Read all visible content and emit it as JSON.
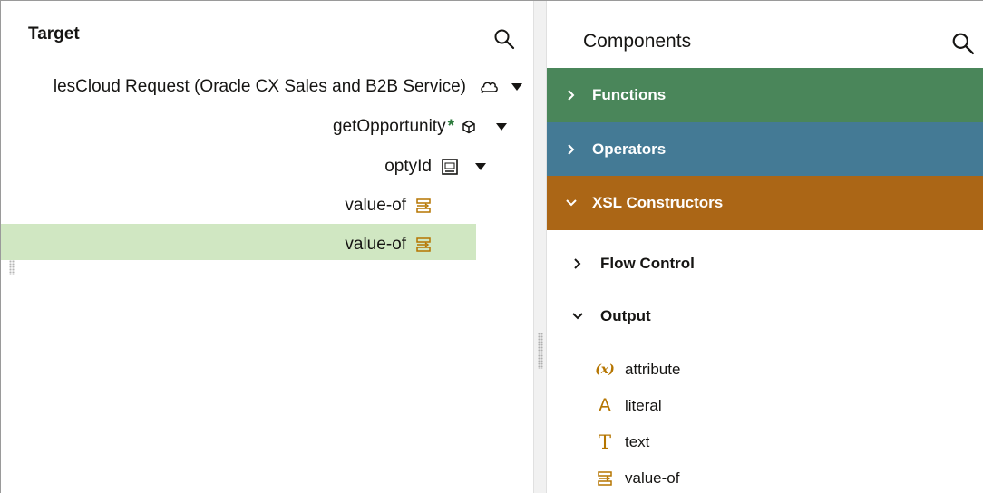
{
  "target_panel": {
    "title": "Target",
    "search_icon": "search-icon",
    "tree": [
      {
        "label": "lesCloud Request (Oracle CX Sales and B2B Service)",
        "icon": "cloud-icon",
        "expanded": true
      },
      {
        "label": "getOpportunity",
        "required_marker": "*",
        "icon": "cube-icon",
        "expanded": true
      },
      {
        "label": "optyId",
        "icon": "number-field-icon",
        "expanded": true
      },
      {
        "label": "value-of",
        "icon": "value-of-icon"
      },
      {
        "label": "value-of",
        "icon": "value-of-icon",
        "selected": true
      }
    ]
  },
  "components_panel": {
    "title": "Components",
    "search_icon": "search-icon",
    "categories": [
      {
        "label": "Functions",
        "expanded": false,
        "color": "#4a865a"
      },
      {
        "label": "Operators",
        "expanded": false,
        "color": "#447a95"
      },
      {
        "label": "XSL Constructors",
        "expanded": true,
        "color": "#ab6616"
      }
    ],
    "subsections": [
      {
        "label": "Flow Control",
        "expanded": false
      },
      {
        "label": "Output",
        "expanded": true
      }
    ],
    "output_items": [
      {
        "label": "attribute",
        "icon": "(x)"
      },
      {
        "label": "literal",
        "icon": "A"
      },
      {
        "label": "text",
        "icon": "T"
      },
      {
        "label": "value-of",
        "icon": "value-of-icon"
      }
    ]
  },
  "colors": {
    "selected_row": "#d0e7c2",
    "icon_accent": "#b57500",
    "required_star": "#2b7a3b"
  }
}
